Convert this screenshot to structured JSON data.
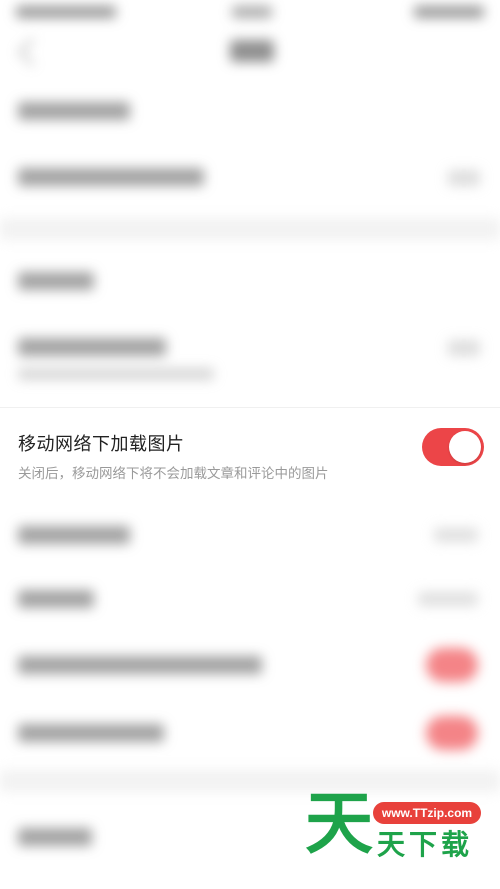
{
  "setting": {
    "title": "移动网络下加载图片",
    "description": "关闭后，移动网络下将不会加载文章和评论中的图片",
    "toggle_on": true
  },
  "colors": {
    "toggle_on": "#ec4548",
    "title_text": "#222222",
    "description_text": "#9a9a9a"
  },
  "watermark": {
    "url": "www.TTzip.com",
    "char_large": "天",
    "text": "天下载"
  }
}
